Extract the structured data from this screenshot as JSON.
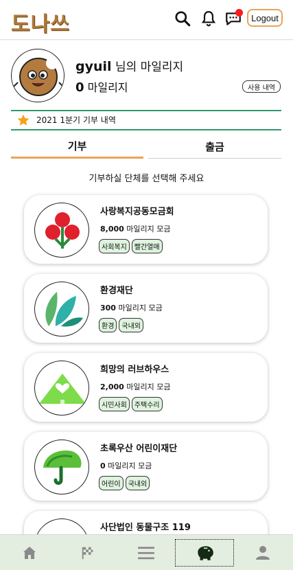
{
  "header": {
    "logo_text": "도나쓰",
    "logout_label": "Logout",
    "icons": [
      "search-icon",
      "bell-icon",
      "chat-icon"
    ]
  },
  "profile": {
    "username": "gyuil",
    "username_suffix": "님의 마일리지",
    "mileage_value": "0",
    "mileage_unit": "마일리지",
    "history_button": "사용 내역",
    "quarter_text": "2021 1분기 기부 내역"
  },
  "tabs": {
    "donate": "기부",
    "attendance": "출금"
  },
  "prompt": "기부하실 단체를 선택해 주세요",
  "organizations": [
    {
      "name": "사랑복지공동모금회",
      "amount": "8,000",
      "unit": "마일리지 모금",
      "tags": [
        "사회복지",
        "빨간열매"
      ]
    },
    {
      "name": "환경재단",
      "amount": "300",
      "unit": "마일리지 모금",
      "tags": [
        "환경",
        "국내외"
      ]
    },
    {
      "name": "희망의 러브하우스",
      "amount": "2,000",
      "unit": "마일리지 모금",
      "tags": [
        "시민사회",
        "주택수리"
      ]
    },
    {
      "name": "초록우산 어린이재단",
      "amount": "0",
      "unit": "마일리지 모금",
      "tags": [
        "어린이",
        "국내외"
      ]
    },
    {
      "name": "사단법인 동물구조 119",
      "amount": "",
      "unit": "",
      "tags": []
    }
  ],
  "bottom_nav": [
    "home-icon",
    "flag-icon",
    "menu-icon",
    "piggy-bank-icon",
    "person-icon"
  ],
  "colors": {
    "accent": "#e9a35a",
    "green": "#2e9a6a",
    "tag_bg": "#dff3df",
    "notification": "#ff1a1a"
  }
}
